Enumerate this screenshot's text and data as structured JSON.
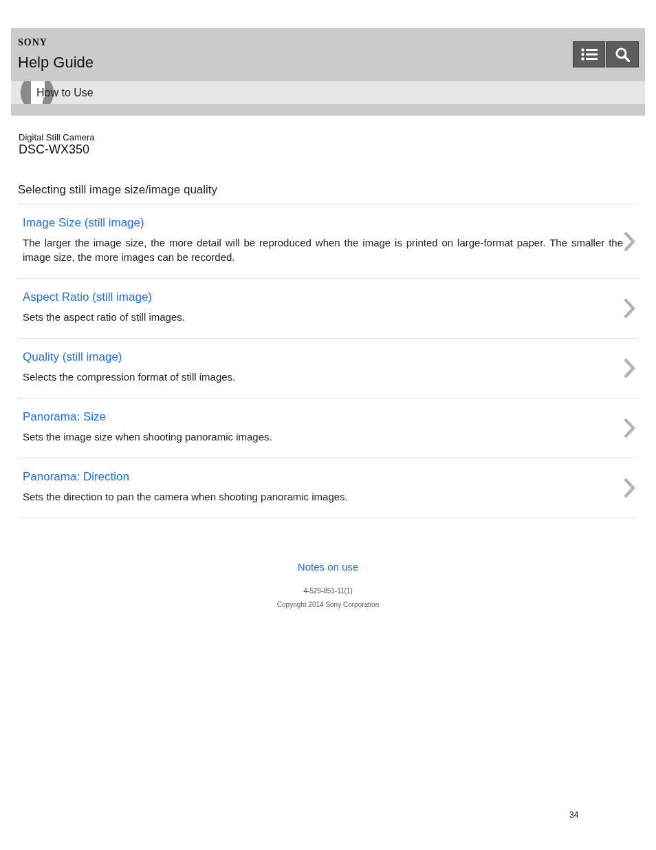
{
  "header": {
    "logo": "SONY",
    "title": "Help Guide"
  },
  "breadcrumb": {
    "label": "How to Use"
  },
  "product": {
    "category": "Digital Still Camera",
    "model": "DSC-WX350"
  },
  "page_title": "Selecting still image size/image quality",
  "topics": [
    {
      "title": "Image Size (still image)",
      "description": "The larger the image size, the more detail will be reproduced when the image is printed on large-format paper. The smaller the image size, the more images can be recorded."
    },
    {
      "title": "Aspect Ratio (still image)",
      "description": "Sets the aspect ratio of still images."
    },
    {
      "title": "Quality (still image)",
      "description": "Selects the compression format of still images."
    },
    {
      "title": "Panorama: Size",
      "description": "Sets the image size when shooting panoramic images."
    },
    {
      "title": "Panorama: Direction",
      "description": "Sets the direction to pan the camera when shooting panoramic images."
    }
  ],
  "footer": {
    "link": "Notes on use",
    "code": "4-529-851-11(1)",
    "copyright": "Copyright 2014 Sony Corporation"
  },
  "page_number": "34"
}
